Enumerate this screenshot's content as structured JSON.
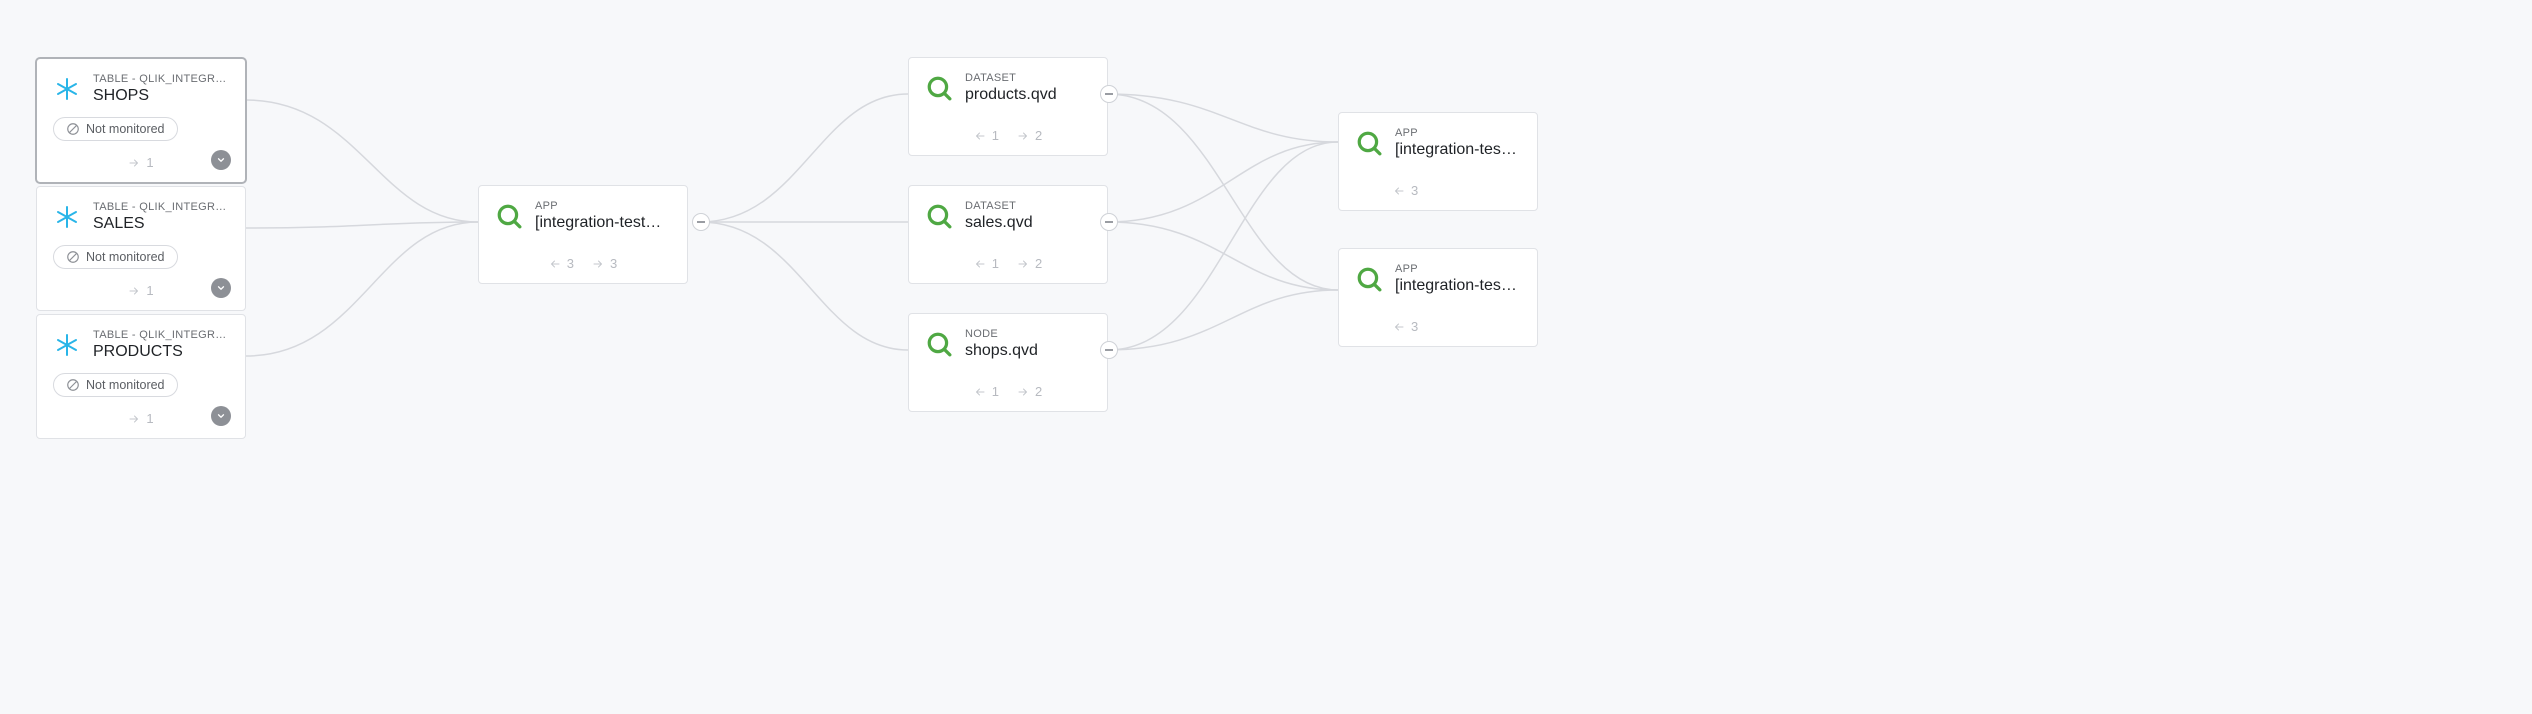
{
  "colors": {
    "qlik": "#4fa843",
    "snowflake": "#29b5e8",
    "muted": "#b7bac0"
  },
  "nodes": {
    "shops": {
      "kicker": "TABLE - QLIK_INTEGRATION_TES…",
      "title": "SHOPS",
      "status": "Not monitored",
      "out": "1"
    },
    "sales": {
      "kicker": "TABLE - QLIK_INTEGRATION_TES…",
      "title": "SALES",
      "status": "Not monitored",
      "out": "1"
    },
    "products": {
      "kicker": "TABLE - QLIK_INTEGRATION_TES…",
      "title": "PRODUCTS",
      "status": "Not monitored",
      "out": "1"
    },
    "app_mid": {
      "kicker": "APP",
      "title": "[integration-test…",
      "in": "3",
      "out": "3"
    },
    "ds_products": {
      "kicker": "DATASET",
      "title": "products.qvd",
      "in": "1",
      "out": "2"
    },
    "ds_sales": {
      "kicker": "DATASET",
      "title": "sales.qvd",
      "in": "1",
      "out": "2"
    },
    "ds_shops": {
      "kicker": "NODE",
      "title": "shops.qvd",
      "in": "1",
      "out": "2"
    },
    "app_top": {
      "kicker": "APP",
      "title": "[integration-test…",
      "in": "3"
    },
    "app_bot": {
      "kicker": "APP",
      "title": "[integration-test…",
      "in": "3"
    }
  }
}
